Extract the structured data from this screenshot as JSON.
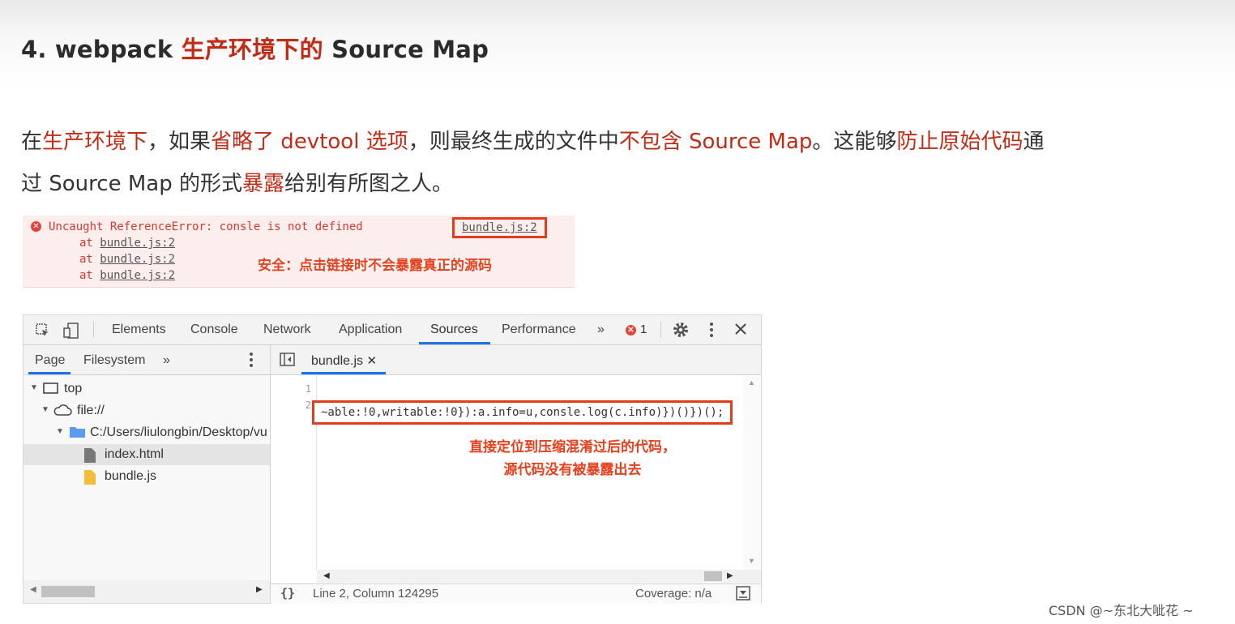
{
  "heading": {
    "prefix": "4. webpack ",
    "highlight": "生产环境下的",
    "suffix": " Source Map"
  },
  "paragraph": {
    "line1": [
      {
        "t": "在",
        "r": false
      },
      {
        "t": "生产环境下",
        "r": true
      },
      {
        "t": "，如果",
        "r": false
      },
      {
        "t": "省略了 devtool 选项",
        "r": true
      },
      {
        "t": "，则最终生成的文件中",
        "r": false
      },
      {
        "t": "不包含 Source Map",
        "r": true
      },
      {
        "t": "。这能够",
        "r": false
      },
      {
        "t": "防止原始代码",
        "r": true
      },
      {
        "t": "通",
        "r": false
      }
    ],
    "line2": [
      {
        "t": "过 Source Map 的形式",
        "r": false
      },
      {
        "t": "暴露",
        "r": true
      },
      {
        "t": "给别有所图之人。",
        "r": false
      }
    ]
  },
  "error_console": {
    "message": "Uncaught ReferenceError: consle is not defined",
    "link": "bundle.js:2",
    "at_prefix": "at ",
    "stack": [
      "bundle.js:2",
      "bundle.js:2",
      "bundle.js:2"
    ],
    "callout": "安全：点击链接时不会暴露真正的源码"
  },
  "devtools": {
    "tabs": [
      "Elements",
      "Console",
      "Network",
      "Application",
      "Sources",
      "Performance"
    ],
    "more_tabs": "»",
    "error_count": "1",
    "sidebar_tabs": [
      "Page",
      "Filesystem"
    ],
    "sidebar_more": "»",
    "tree": [
      {
        "label": "top"
      },
      {
        "label": "file://"
      },
      {
        "label": "C:/Users/liulongbin/Desktop/vu"
      },
      {
        "label": "index.html"
      },
      {
        "label": "bundle.js"
      }
    ],
    "open_file": "bundle.js",
    "line_numbers": [
      "1",
      "2"
    ],
    "code": "~able:!0,writable:!0}):a.info=u,consle.log(c.info)})()})();",
    "callout_lines": [
      "直接定位到压缩混淆过后的代码，",
      "源代码没有被暴露出去"
    ],
    "status_position": "Line 2, Column 124295",
    "coverage": "Coverage: n/a"
  },
  "watermark": "CSDN @~东北大呲花 ~"
}
